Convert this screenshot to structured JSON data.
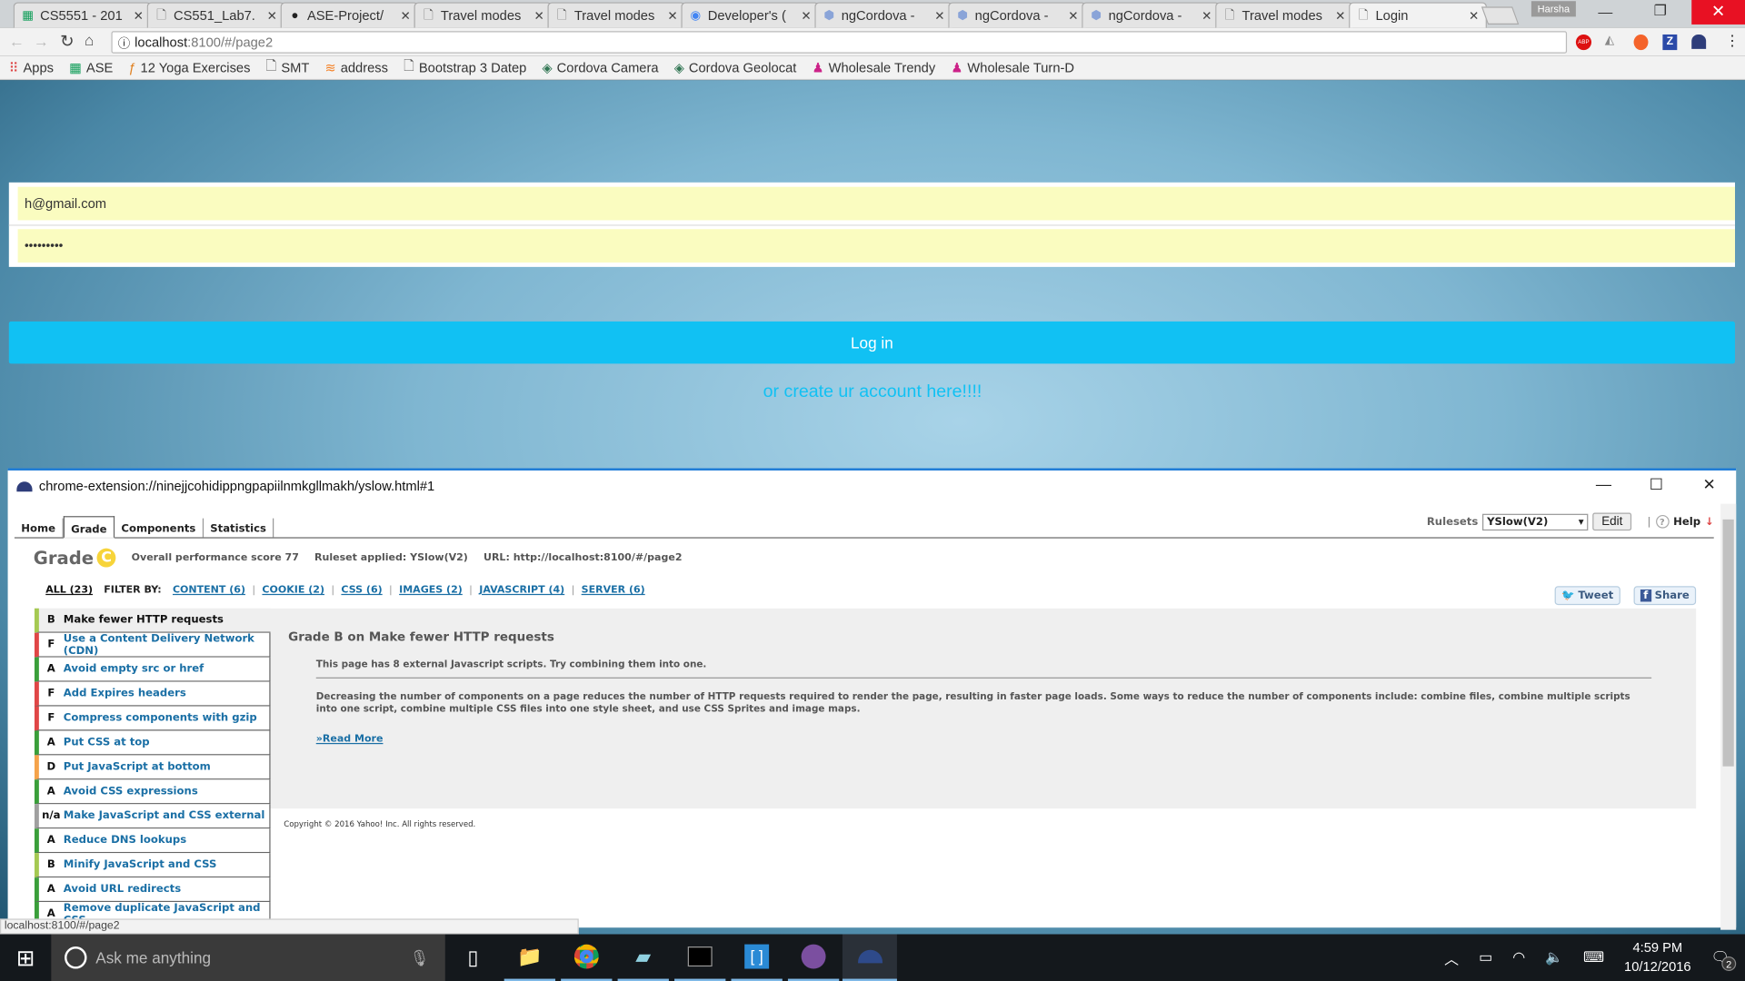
{
  "browser": {
    "tabs": [
      {
        "title": "CS5551 - 201",
        "icon": "sheets-icon"
      },
      {
        "title": "CS551_Lab7.",
        "icon": "page-icon"
      },
      {
        "title": "ASE-Project/",
        "icon": "github-icon"
      },
      {
        "title": "Travel modes",
        "icon": "page-icon"
      },
      {
        "title": "Travel modes",
        "icon": "page-icon"
      },
      {
        "title": "Developer's (",
        "icon": "google-dev-icon"
      },
      {
        "title": "ngCordova -",
        "icon": "ngcordova-icon"
      },
      {
        "title": "ngCordova -",
        "icon": "ngcordova-icon"
      },
      {
        "title": "ngCordova -",
        "icon": "ngcordova-icon"
      },
      {
        "title": "Travel modes",
        "icon": "page-icon"
      },
      {
        "title": "Login",
        "icon": "page-icon",
        "active": true
      }
    ],
    "profile": "Harsha",
    "url_host": "localhost",
    "url_rest": ":8100/#/page2",
    "bookmarks": [
      "Apps",
      "ASE",
      "12 Yoga Exercises",
      "SMT",
      "address",
      "Bootstrap 3 Datep",
      "Cordova Camera",
      "Cordova Geolocat",
      "Wholesale Trendy",
      "Wholesale Turn-D"
    ],
    "extensions": [
      "ABP",
      "Z"
    ]
  },
  "login": {
    "email_value": "h@gmail.com",
    "password_value": "•••••••••",
    "login_button": "Log in",
    "create_link": "or create ur account here!!!!",
    "accent": "#11c1f3",
    "autofill_color": "#fafcc0"
  },
  "yslow": {
    "window_title": "chrome-extension://ninejjcohidippngpapiilnmkgllmakh/yslow.html#1",
    "tabs": [
      "Home",
      "Grade",
      "Components",
      "Statistics"
    ],
    "active_tab": "Grade",
    "rulesets_label": "Rulesets",
    "ruleset_value": "YSlow(V2)",
    "edit_label": "Edit",
    "help_label": "Help",
    "grade_label": "Grade",
    "grade": "C",
    "score_text": "Overall performance score 77",
    "ruleset_text": "Ruleset applied: YSlow(V2)",
    "url_text": "URL: http://localhost:8100/#/page2",
    "filter_all": "ALL (23)",
    "filter_by": "FILTER BY:",
    "filters": [
      "CONTENT (6)",
      "COOKIE (2)",
      "CSS (6)",
      "IMAGES (2)",
      "JAVASCRIPT (4)",
      "SERVER (6)"
    ],
    "tweet": "Tweet",
    "share": "Share",
    "rules": [
      {
        "grade": "B",
        "name": "Make fewer HTTP requests",
        "color": "#a5c952"
      },
      {
        "grade": "F",
        "name": "Use a Content Delivery Network (CDN)",
        "color": "#e04646"
      },
      {
        "grade": "A",
        "name": "Avoid empty src or href",
        "color": "#3a9f3a"
      },
      {
        "grade": "F",
        "name": "Add Expires headers",
        "color": "#e04646"
      },
      {
        "grade": "F",
        "name": "Compress components with gzip",
        "color": "#e04646"
      },
      {
        "grade": "A",
        "name": "Put CSS at top",
        "color": "#3a9f3a"
      },
      {
        "grade": "D",
        "name": "Put JavaScript at bottom",
        "color": "#f5a34a"
      },
      {
        "grade": "A",
        "name": "Avoid CSS expressions",
        "color": "#3a9f3a"
      },
      {
        "grade": "n/a",
        "name": "Make JavaScript and CSS external",
        "color": "#a0a0a0"
      },
      {
        "grade": "A",
        "name": "Reduce DNS lookups",
        "color": "#3a9f3a"
      },
      {
        "grade": "B",
        "name": "Minify JavaScript and CSS",
        "color": "#a5c952"
      },
      {
        "grade": "A",
        "name": "Avoid URL redirects",
        "color": "#3a9f3a"
      },
      {
        "grade": "A",
        "name": "Remove duplicate JavaScript and CSS",
        "color": "#3a9f3a"
      }
    ],
    "detail_title": "Grade B on Make fewer HTTP requests",
    "detail_summary": "This page has 8 external Javascript scripts. Try combining them into one.",
    "detail_body": "Decreasing the number of components on a page reduces the number of HTTP requests required to render the page, resulting in faster page loads. Some ways to reduce the number of components include: combine files, combine multiple scripts into one script, combine multiple CSS files into one style sheet, and use CSS Sprites and image maps.",
    "read_more": "»Read More",
    "copyright": "Copyright © 2016 Yahoo! Inc. All rights reserved."
  },
  "status_bar": "localhost:8100/#/page2",
  "taskbar": {
    "search_placeholder": "Ask me anything",
    "time": "4:59 PM",
    "date": "10/12/2016",
    "notifications": "2"
  }
}
